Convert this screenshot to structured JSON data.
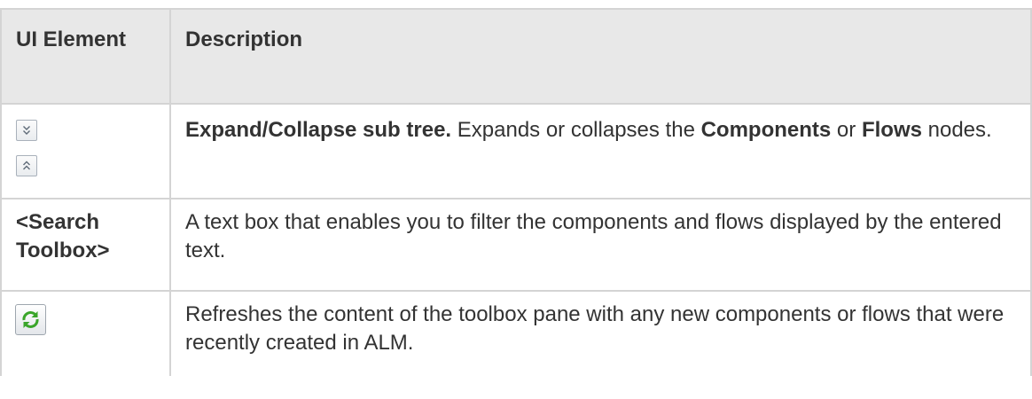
{
  "header": {
    "col1": "UI Element",
    "col2": "Description"
  },
  "rows": [
    {
      "icons": [
        "expand-all-icon",
        "collapse-all-icon"
      ],
      "desc_bold": "Expand/Collapse sub tree.",
      "desc_text1": " Expands or collapses the ",
      "bold2": "Components",
      "desc_text2": " or ",
      "bold3": "Flows",
      "desc_text3": " nodes."
    },
    {
      "element": "<Search Toolbox>",
      "desc": "A text box that enables you to filter the components and flows displayed by the entered text."
    },
    {
      "icons": [
        "refresh-icon"
      ],
      "desc": "Refreshes the content of the toolbox pane with any new components or flows that were recently created in ALM."
    }
  ],
  "colors": {
    "header_bg": "#e8e8e8",
    "border": "#d4d4d4",
    "text": "#333333",
    "icon_green": "#3aa52a"
  }
}
